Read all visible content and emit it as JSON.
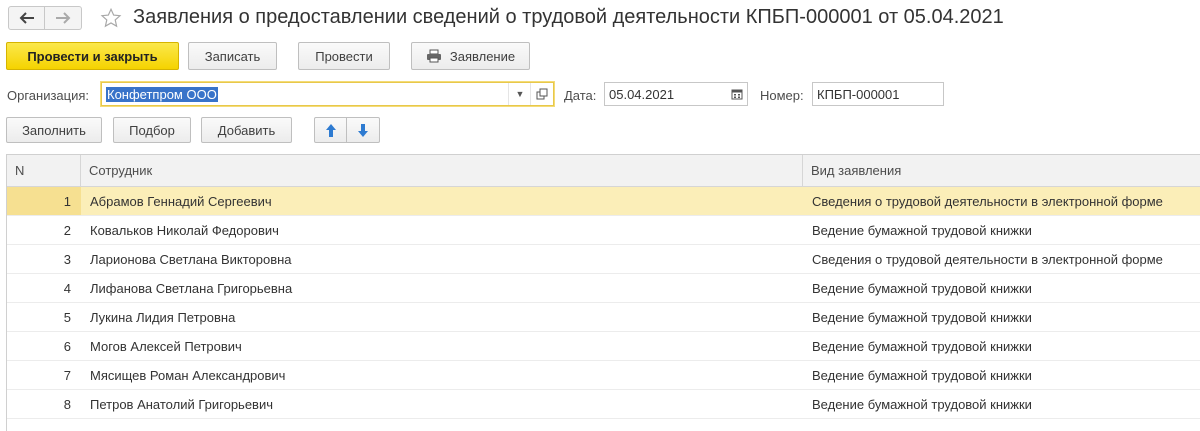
{
  "window": {
    "title": "Заявления о предоставлении сведений о трудовой деятельности КПБП-000001 от 05.04.2021",
    "nav": {
      "back_icon": "arrow-left-icon",
      "forward_icon": "arrow-right-icon"
    },
    "favorite_icon": "star-outline-icon"
  },
  "toolbar": {
    "post_and_close": "Провести и закрыть",
    "save": "Записать",
    "post": "Провести",
    "print_statement": "Заявление",
    "print_icon": "printer-icon"
  },
  "fields": {
    "organization_label": "Организация:",
    "organization_value": "Конфетпром ООО",
    "date_label": "Дата:",
    "date_value": "05.04.2021",
    "number_label": "Номер:",
    "number_value": "КПБП-000001"
  },
  "table_toolbar": {
    "fill": "Заполнить",
    "select": "Подбор",
    "add": "Добавить",
    "move_up_icon": "arrow-up-icon",
    "move_down_icon": "arrow-down-icon"
  },
  "table": {
    "columns": [
      "N",
      "Сотрудник",
      "Вид заявления"
    ],
    "rows": [
      {
        "n": "1",
        "employee": "Абрамов Геннадий Сергеевич",
        "kind": "Сведения о трудовой деятельности в электронной форме"
      },
      {
        "n": "2",
        "employee": "Ковальков Николай Федорович",
        "kind": "Ведение бумажной трудовой книжки"
      },
      {
        "n": "3",
        "employee": "Ларионова Светлана Викторовна",
        "kind": "Сведения о трудовой деятельности в электронной форме"
      },
      {
        "n": "4",
        "employee": "Лифанова Светлана Григорьевна",
        "kind": "Ведение бумажной трудовой книжки"
      },
      {
        "n": "5",
        "employee": "Лукина Лидия Петровна",
        "kind": "Ведение бумажной трудовой книжки"
      },
      {
        "n": "6",
        "employee": "Могов Алексей Петрович",
        "kind": "Ведение бумажной трудовой книжки"
      },
      {
        "n": "7",
        "employee": "Мясищев Роман Александрович",
        "kind": "Ведение бумажной трудовой книжки"
      },
      {
        "n": "8",
        "employee": "Петров Анатолий Григорьевич",
        "kind": "Ведение бумажной трудовой книжки"
      }
    ],
    "selected_row": 1
  },
  "colors": {
    "primary_button": "#f5d300",
    "selected_row": "#fbeeb8",
    "selection_highlight": "#3873c9",
    "arrow_blue": "#2e7bd1"
  }
}
